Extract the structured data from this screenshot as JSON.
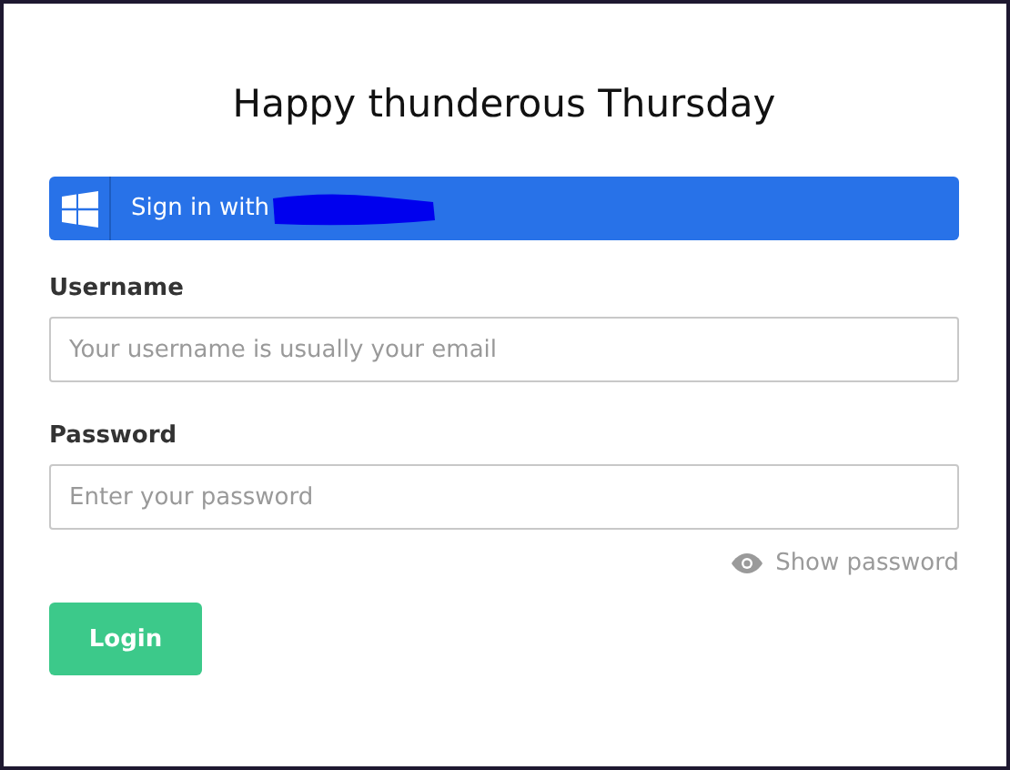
{
  "title": "Happy thunderous Thursday",
  "sso_button": {
    "label": "Sign in with",
    "redacted": true
  },
  "fields": [
    {
      "label": "Username",
      "placeholder": "Your username is usually your email"
    },
    {
      "label": "Password",
      "placeholder": "Enter your password"
    }
  ],
  "show_password": {
    "label": "Show password"
  },
  "login_button": {
    "label": "Login"
  }
}
